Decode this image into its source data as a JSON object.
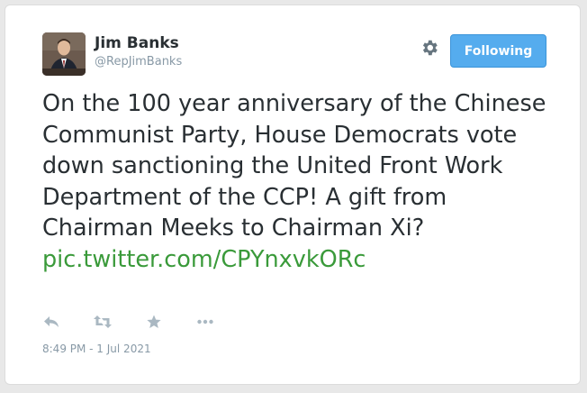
{
  "author": {
    "name": "Jim Banks",
    "handle": "@RepJimBanks"
  },
  "follow_button": {
    "label": "Following"
  },
  "tweet": {
    "text": "On the 100 year anniversary of the Chinese Communist Party, House Democrats vote down sanctioning the United Front Work Department of the CCP! A gift from Chairman Meeks to Chairman Xi?",
    "link": "pic.twitter.com/CPYnxvkORc",
    "timestamp": "8:49 PM - 1 Jul 2021"
  },
  "icons": {
    "settings": "gear-icon",
    "reply": "reply-icon",
    "retweet": "retweet-icon",
    "favorite": "star-icon",
    "more": "more-icon"
  },
  "colors": {
    "follow_button": "#55acee",
    "link": "#3a9a3a",
    "text": "#292f33",
    "muted": "#8899a6",
    "icon": "#aab8c2"
  }
}
